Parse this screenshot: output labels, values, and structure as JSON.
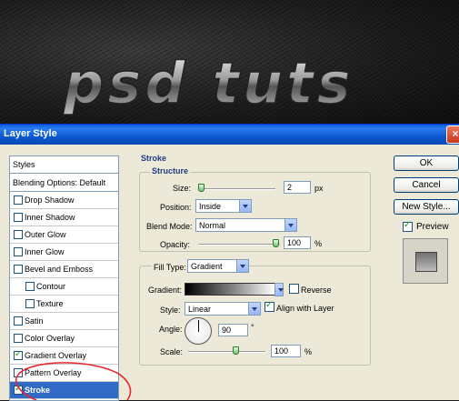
{
  "artwork": {
    "title_text": "psd tuts"
  },
  "dialog": {
    "title": "Layer Style",
    "close_icon": "×",
    "styles_header": "Styles",
    "blending_options": "Blending Options: Default",
    "items": [
      {
        "label": "Drop Shadow",
        "checked": false
      },
      {
        "label": "Inner Shadow",
        "checked": false
      },
      {
        "label": "Outer Glow",
        "checked": false
      },
      {
        "label": "Inner Glow",
        "checked": false
      },
      {
        "label": "Bevel and Emboss",
        "checked": false
      },
      {
        "label": "Contour",
        "checked": false,
        "indent": true
      },
      {
        "label": "Texture",
        "checked": false,
        "indent": true
      },
      {
        "label": "Satin",
        "checked": false
      },
      {
        "label": "Color Overlay",
        "checked": false
      },
      {
        "label": "Gradient Overlay",
        "checked": true
      },
      {
        "label": "Pattern Overlay",
        "checked": false
      },
      {
        "label": "Stroke",
        "checked": true,
        "selected": true
      }
    ],
    "buttons": {
      "ok": "OK",
      "cancel": "Cancel",
      "new_style": "New Style..."
    },
    "preview_label": "Preview",
    "stroke": {
      "heading": "Stroke",
      "structure_legend": "Structure",
      "size_label": "Size:",
      "size_value": "2",
      "size_unit": "px",
      "size_level": 0.02,
      "position_label": "Position:",
      "position_value": "Inside",
      "blend_mode_label": "Blend Mode:",
      "blend_mode_value": "Normal",
      "opacity_label": "Opacity:",
      "opacity_value": "100",
      "opacity_unit": "%",
      "fill_type_label": "Fill Type:",
      "fill_type_value": "Gradient",
      "gradient_label": "Gradient:",
      "reverse_label": "Reverse",
      "reverse_checked": false,
      "style_label": "Style:",
      "style_value": "Linear",
      "align_label": "Align with Layer",
      "align_checked": true,
      "angle_label": "Angle:",
      "angle_value": "90",
      "angle_unit": "°",
      "scale_label": "Scale:",
      "scale_value": "100",
      "scale_unit": "%"
    }
  },
  "colors": {
    "selection": "#316ac5",
    "titlebar": "#0a5fd8",
    "annotation": "#e8262e"
  }
}
